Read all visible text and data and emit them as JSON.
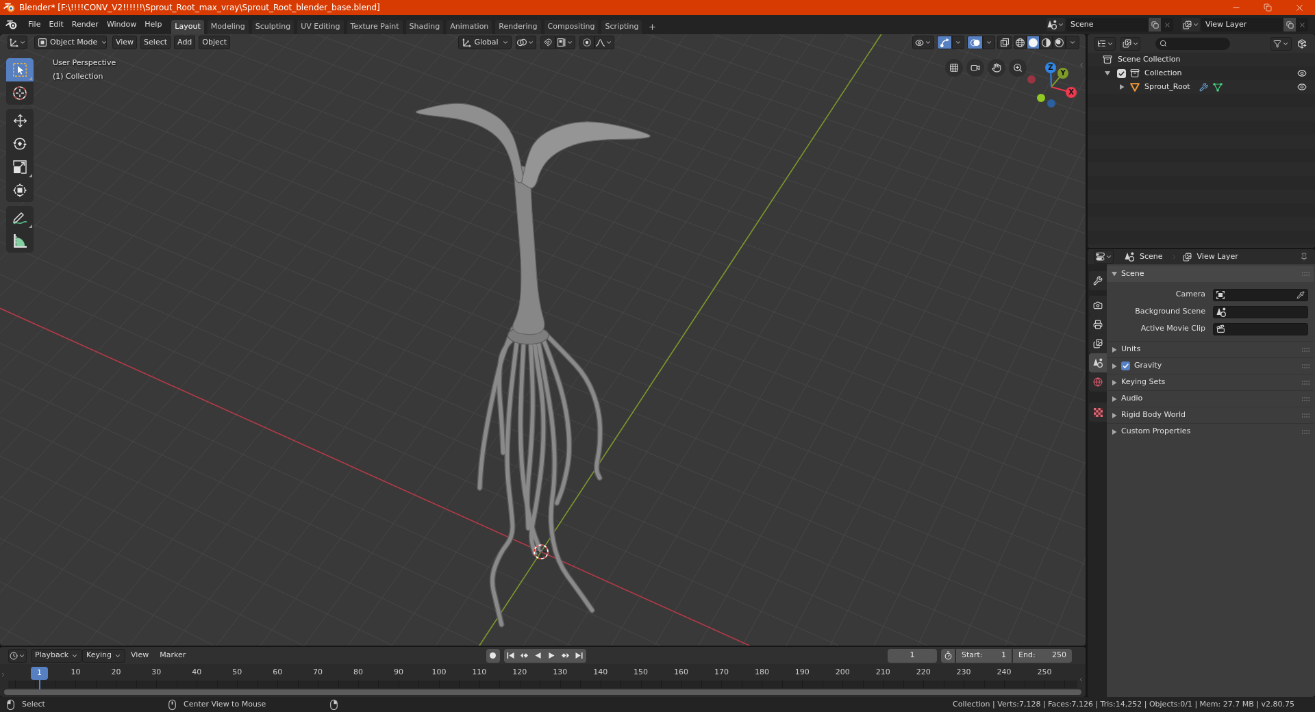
{
  "title_bar": {
    "title": "Blender* [F:\\!!!!CONV_V2!!!!!!\\Sprout_Root_max_vray\\Sprout_Root_blender_base.blend]"
  },
  "top_bar": {
    "menus": [
      "File",
      "Edit",
      "Render",
      "Window",
      "Help"
    ],
    "workspaces": [
      {
        "label": "Layout",
        "selected": true
      },
      {
        "label": "Modeling",
        "selected": false
      },
      {
        "label": "Sculpting",
        "selected": false
      },
      {
        "label": "UV Editing",
        "selected": false
      },
      {
        "label": "Texture Paint",
        "selected": false
      },
      {
        "label": "Shading",
        "selected": false
      },
      {
        "label": "Animation",
        "selected": false
      },
      {
        "label": "Rendering",
        "selected": false
      },
      {
        "label": "Compositing",
        "selected": false
      },
      {
        "label": "Scripting",
        "selected": false
      }
    ],
    "selectors": [
      {
        "kind": "scene",
        "label": "Scene"
      },
      {
        "kind": "view_layer",
        "label": "View Layer"
      }
    ]
  },
  "viewport": {
    "header": {
      "mode": "Object Mode",
      "menus": [
        "View",
        "Select",
        "Add",
        "Object"
      ],
      "orientation": "Global",
      "gizmos_on": true,
      "overlays_on": true,
      "shading": [
        {
          "kind": "wireframe",
          "selected": false
        },
        {
          "kind": "solid",
          "selected": true
        },
        {
          "kind": "material",
          "selected": false
        },
        {
          "kind": "rendered",
          "selected": false
        }
      ]
    },
    "info": [
      "User Perspective",
      "(1) Collection"
    ],
    "tool_groups": [
      {
        "tools": [
          {
            "kind": "select_box",
            "selected": true
          },
          {
            "kind": "cursor",
            "selected": false
          }
        ]
      },
      {
        "tools": [
          {
            "kind": "move",
            "selected": false
          },
          {
            "kind": "rotate",
            "selected": false
          },
          {
            "kind": "scale",
            "selected": false
          },
          {
            "kind": "transform",
            "selected": false
          }
        ]
      },
      {
        "tools": [
          {
            "kind": "annotate",
            "selected": false
          },
          {
            "kind": "measure",
            "selected": false
          }
        ]
      }
    ],
    "gizmo": {
      "axes": [
        {
          "label": "X",
          "color": "#f0384e"
        },
        {
          "label": "Y",
          "color": "#7d9a2a"
        },
        {
          "label": "Z",
          "color": "#2f86e6"
        }
      ],
      "negative_axes": [
        {
          "color": "#9a3442"
        },
        {
          "color": "#92c822"
        },
        {
          "color": "#2b5f9e"
        }
      ]
    }
  },
  "outliner": {
    "tree": [
      {
        "label": "Scene Collection",
        "kind": "scene_collection",
        "children": [
          {
            "label": "Collection",
            "kind": "collection",
            "expanded": true,
            "checked": true,
            "visible": true,
            "children": [
              {
                "label": "Sprout_Root",
                "kind": "mesh_object",
                "expanded": false,
                "visible": true
              }
            ]
          }
        ]
      }
    ]
  },
  "properties": {
    "breadcrumb": [
      {
        "kind": "scene",
        "label": "Scene"
      },
      {
        "kind": "view_layer",
        "label": "View Layer"
      }
    ],
    "tab_groups": [
      {
        "tabs": [
          {
            "kind": "tool",
            "selected": false
          }
        ]
      },
      {
        "tabs": [
          {
            "kind": "render",
            "selected": false
          },
          {
            "kind": "output",
            "selected": false
          },
          {
            "kind": "view_layer",
            "selected": false
          },
          {
            "kind": "scene",
            "selected": true
          },
          {
            "kind": "world",
            "selected": false
          }
        ]
      },
      {
        "tabs": [
          {
            "kind": "texture",
            "selected": false
          }
        ]
      }
    ],
    "scene_panel": {
      "title": "Scene",
      "expanded": true,
      "fields": [
        {
          "label": "Camera",
          "kind": "camera"
        },
        {
          "label": "Background Scene",
          "kind": "scene"
        },
        {
          "label": "Active Movie Clip",
          "kind": "movie_clip"
        }
      ]
    },
    "panels": [
      {
        "label": "Units",
        "expanded": false
      },
      {
        "label": "Gravity",
        "expanded": false,
        "toggle": {
          "checked": true
        }
      },
      {
        "label": "Keying Sets",
        "expanded": false
      },
      {
        "label": "Audio",
        "expanded": false
      },
      {
        "label": "Rigid Body World",
        "expanded": false
      },
      {
        "label": "Custom Properties",
        "expanded": false
      }
    ]
  },
  "timeline": {
    "menus": [
      {
        "label": "Playback",
        "kind": "dropdown"
      },
      {
        "label": "Keying",
        "kind": "dropdown"
      },
      {
        "label": "View",
        "kind": "menu"
      },
      {
        "label": "Marker",
        "kind": "menu"
      }
    ],
    "auto_keying": false,
    "current_frame": "1",
    "use_preview_range": false,
    "start": {
      "label": "Start:",
      "value": "1"
    },
    "end": {
      "label": "End:",
      "value": "250"
    },
    "ruler": {
      "current": "1",
      "labels": [
        "10",
        "20",
        "30",
        "40",
        "50",
        "60",
        "70",
        "80",
        "90",
        "100",
        "110",
        "120",
        "130",
        "140",
        "150",
        "160",
        "170",
        "180",
        "190",
        "200",
        "210",
        "220",
        "230",
        "240",
        "250"
      ]
    }
  },
  "status_bar": {
    "hints": [
      {
        "kind": "left_click",
        "label": "Select"
      },
      {
        "kind": "middle_click",
        "label": "Center View to Mouse"
      },
      {
        "kind": "right_click"
      }
    ],
    "stats": "Collection | Verts:7,128 | Faces:7,126 | Tris:14,252 | Objects:0/1 | Mem: 27.7 MB | v2.80.75"
  }
}
